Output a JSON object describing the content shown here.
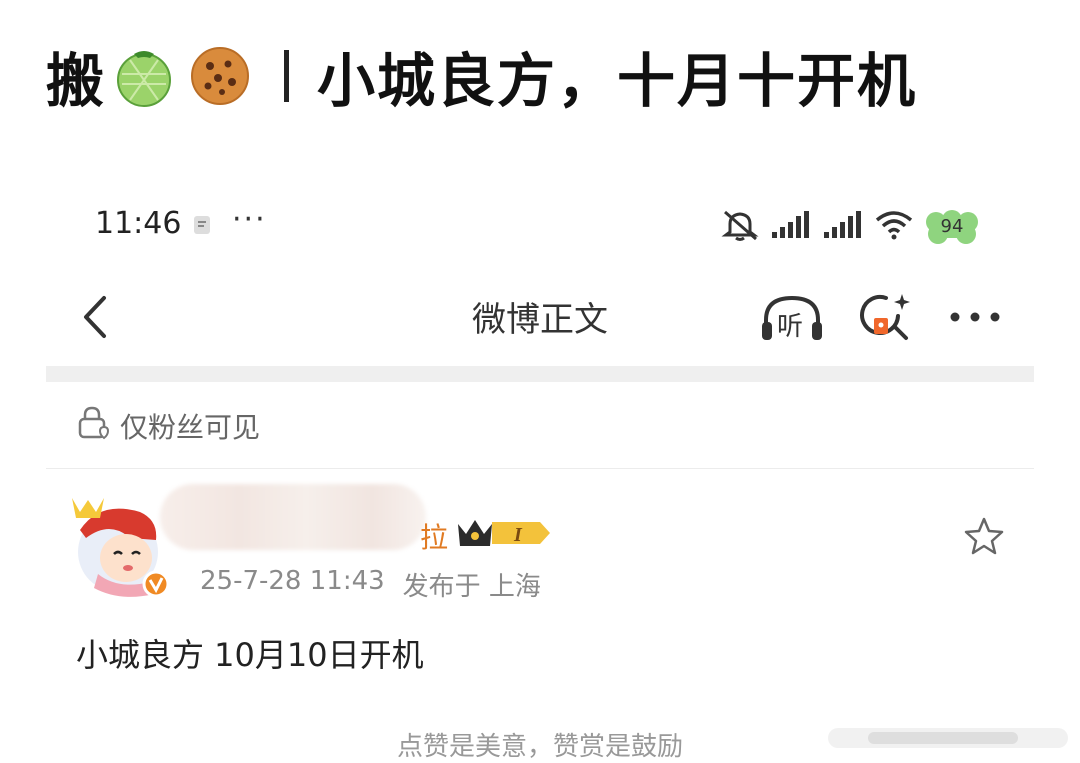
{
  "headline": {
    "prefix": "搬",
    "emoji_1": "melon-emoji",
    "emoji_2": "cookie-emoji",
    "title": "小城良方，十月十开机"
  },
  "status_bar": {
    "time": "11:46",
    "more": "···",
    "battery": "94",
    "icons": [
      "mute-bell-icon",
      "signal-icon",
      "signal-icon",
      "wifi-icon",
      "battery-icon"
    ]
  },
  "nav": {
    "title": "微博正文",
    "listen_label": "听",
    "icons": [
      "back-icon",
      "listen-icon",
      "search-ai-icon",
      "more-icon"
    ]
  },
  "visibility": {
    "label": "仅粉丝可见",
    "icon": "lock-heart-icon"
  },
  "post": {
    "name_tail": "拉",
    "badge_level": "I",
    "timestamp": "25-7-28 11:43",
    "location": "发布于 上海",
    "text": "小城良方 10月10日开机"
  },
  "footer": {
    "text": "点赞是美意，赞赏是鼓励"
  },
  "colors": {
    "accent_orange": "#f08a24",
    "badge_gold": "#f3c23b",
    "battery_green": "#8fd47f"
  }
}
